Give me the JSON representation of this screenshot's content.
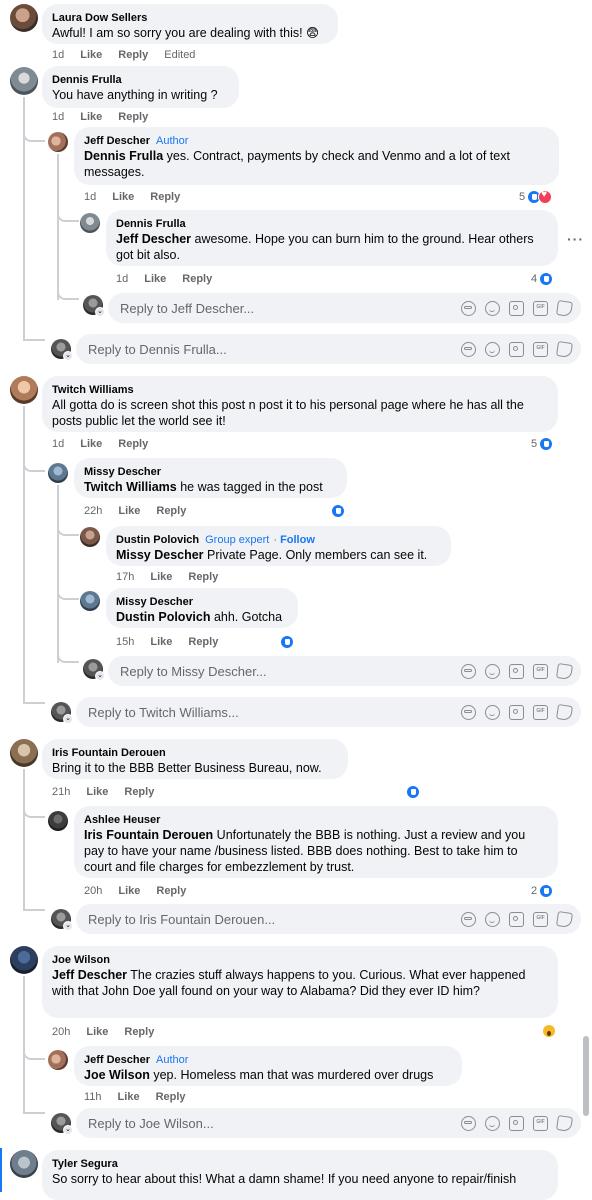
{
  "comments": [
    {
      "author": "Laura Dow Sellers",
      "text": "Awful! I am so sorry you are dealing with this! 😨",
      "time": "1d",
      "like": "Like",
      "reply": "Reply",
      "edited": "Edited"
    },
    {
      "author": "Dennis Frulla",
      "text": "You have anything in writing ?",
      "time": "1d",
      "like": "Like",
      "reply": "Reply",
      "replies": [
        {
          "author": "Jeff Descher",
          "badge": "Author",
          "mention": "Dennis Frulla",
          "text": "yes. Contract, payments by check and Venmo and a lot of text messages.",
          "time": "1d",
          "like": "Like",
          "reply": "Reply",
          "reaction_count": "5"
        },
        {
          "author": "Dennis Frulla",
          "mention": "Jeff Descher",
          "text": "awesome. Hope you can burn him to the ground. Hear others got bit also.",
          "time": "1d",
          "like": "Like",
          "reply": "Reply",
          "reaction_count": "4"
        }
      ],
      "nested_reply_placeholder": "Reply to Jeff Descher...",
      "reply_placeholder": "Reply to Dennis Frulla..."
    },
    {
      "author": "Twitch Williams",
      "text": "All gotta do is screen shot this post n post it to his personal page where he has all the posts public let the world see it!",
      "time": "1d",
      "like": "Like",
      "reply": "Reply",
      "reaction_count": "5",
      "replies": [
        {
          "author": "Missy Descher",
          "mention": "Twitch Williams",
          "text": "he was tagged in the post",
          "time": "22h",
          "like": "Like",
          "reply": "Reply"
        },
        {
          "author": "Dustin Polovich",
          "badge": "Group expert",
          "follow": "Follow",
          "mention": "Missy Descher",
          "text": "Private Page. Only members can see it.",
          "time": "17h",
          "like": "Like",
          "reply": "Reply"
        },
        {
          "author": "Missy Descher",
          "mention": "Dustin Polovich",
          "text": "ahh. Gotcha",
          "time": "15h",
          "like": "Like",
          "reply": "Reply"
        }
      ],
      "nested_reply_placeholder": "Reply to Missy Descher...",
      "reply_placeholder": "Reply to Twitch Williams..."
    },
    {
      "author": "Iris Fountain Derouen",
      "text": "Bring it to the BBB Better Business Bureau, now.",
      "time": "21h",
      "like": "Like",
      "reply": "Reply",
      "replies": [
        {
          "author": "Ashlee Heuser",
          "mention": "Iris Fountain Derouen",
          "text": "Unfortunately the BBB is nothing. Just a review and you pay to have your name /business listed. BBB does nothing. Best to take him to court and file charges for embezzlement by trust.",
          "time": "20h",
          "like": "Like",
          "reply": "Reply",
          "reaction_count": "2"
        }
      ],
      "reply_placeholder": "Reply to Iris Fountain Derouen..."
    },
    {
      "author": "Joe Wilson",
      "mention": "Jeff Descher",
      "text": "The crazies stuff always happens to you. Curious. What ever happened with that John Doe yall found on your way to Alabama? Did they ever ID him?",
      "time": "20h",
      "like": "Like",
      "reply": "Reply",
      "replies": [
        {
          "author": "Jeff Descher",
          "badge": "Author",
          "mention": "Joe Wilson",
          "text": "yep. Homeless man that was murdered over drugs",
          "time": "11h",
          "like": "Like",
          "reply": "Reply"
        }
      ],
      "reply_placeholder": "Reply to Joe Wilson..."
    },
    {
      "author": "Tyler Segura",
      "text": "So sorry to hear about this! What a damn shame! If you need anyone to repair/finish"
    }
  ],
  "icons": {
    "like": "like-reaction-icon",
    "love": "love-reaction-icon",
    "wow": "wow-reaction-icon",
    "more": "more-options-icon"
  },
  "colors": {
    "accent": "#1877f2",
    "bubble": "#f0f2f5",
    "meta": "#65676b"
  }
}
